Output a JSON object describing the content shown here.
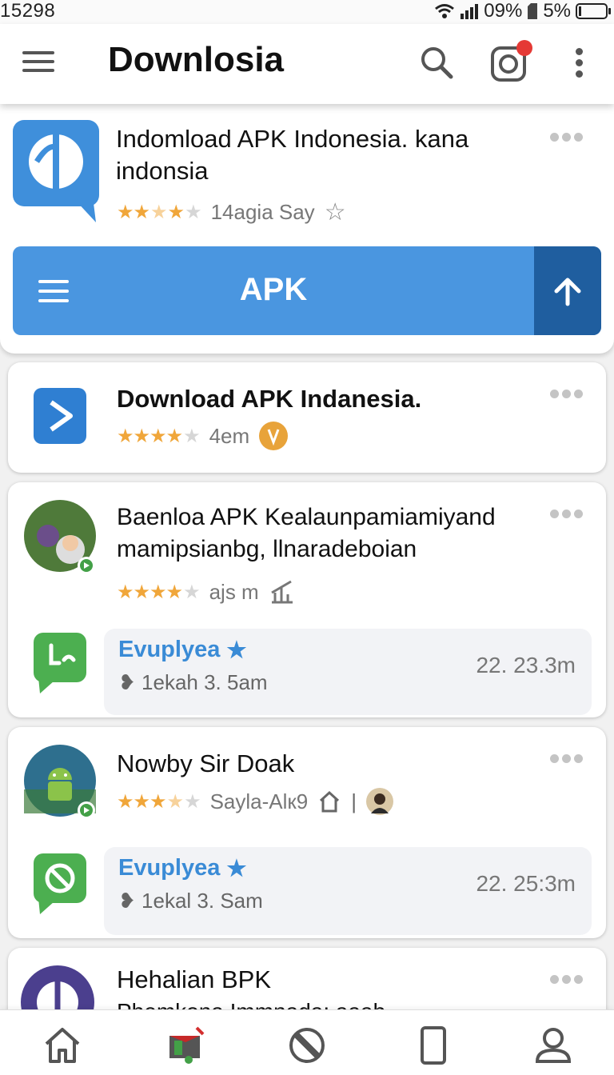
{
  "status": {
    "time": "15298",
    "battery_text": "09%",
    "signal_text": "5%"
  },
  "header": {
    "title": "Downlosia"
  },
  "featured": {
    "title": "Indomload APK Indonesia. kana indonsia",
    "meta": "14agia Say",
    "apk_label": "APK"
  },
  "items": [
    {
      "title": "Download APK Indanesia.",
      "meta": "4em"
    },
    {
      "title": "Baenloa APK Kealaunpamiamiyand mamipsianbg, llnaradeboian",
      "meta": "ajs m",
      "sub": {
        "title": "Evuplyea",
        "meta": "1ekah  3. 5am",
        "right": "22.  23.3m"
      }
    },
    {
      "title": "Nowby Sir Doak",
      "meta": "Sayla-Alк9",
      "sub": {
        "title": "Evuplyea",
        "meta": "1ekal  3. Sam",
        "right": "22.  25:3m"
      }
    },
    {
      "title": "Hehalian BPK",
      "subtitle": "Phemkona Immnada: aaab"
    }
  ],
  "nav": [
    "home-icon",
    "store-icon",
    "block-icon",
    "phone-icon",
    "profile-icon"
  ],
  "colors": {
    "accent": "#4a96e0",
    "accent_dark": "#1f5e9f",
    "star": "#f0a63a",
    "sub_title": "#3a8bd6"
  }
}
